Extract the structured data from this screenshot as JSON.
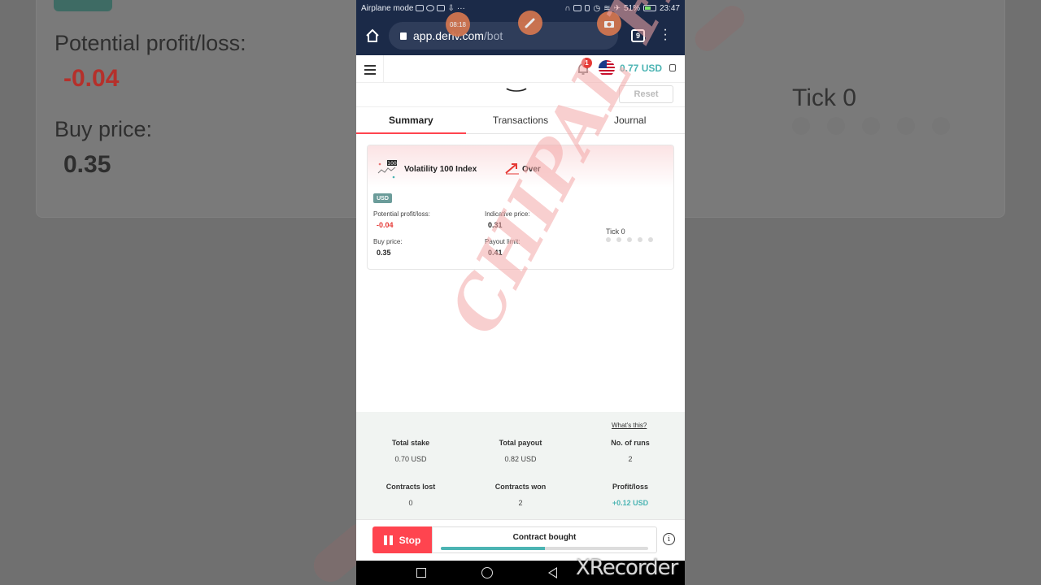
{
  "background": {
    "potential_label": "Potential profit/loss:",
    "potential_value": "-0.04",
    "buy_label": "Buy price:",
    "buy_value": "0.35",
    "tick_label": "Tick 0"
  },
  "statusbar": {
    "mode": "Airplane mode",
    "ellipsis": "···",
    "battery": "51%",
    "time": "23:47"
  },
  "recorder": {
    "timer": "08:18"
  },
  "browser": {
    "url_host": "app.deriv.com",
    "url_path": "/bot",
    "tab_count": "9"
  },
  "appbar": {
    "notification_count": "1",
    "balance": "0.77 USD"
  },
  "toolbar": {
    "reset_label": "Reset"
  },
  "tabs": [
    {
      "label": "Summary",
      "active": true
    },
    {
      "label": "Transactions",
      "active": false
    },
    {
      "label": "Journal",
      "active": false
    }
  ],
  "contract": {
    "icon_badge": "100",
    "market": "Volatility 100 Index",
    "type": "Over",
    "currency": "USD",
    "potential_label": "Potential profit/loss:",
    "potential_value": "-0.04",
    "indicative_label": "Indicative price:",
    "indicative_value": "0.31",
    "buy_label": "Buy price:",
    "buy_value": "0.35",
    "payout_label": "Payout limit:",
    "payout_value": "0.41",
    "tick_label": "Tick 0",
    "tick_dots": 5
  },
  "watermark": "CHIPAL FX",
  "stats": {
    "whats_this": "What's this?",
    "total_stake_label": "Total stake",
    "total_stake": "0.70 USD",
    "total_payout_label": "Total payout",
    "total_payout": "0.82 USD",
    "runs_label": "No. of runs",
    "runs": "2",
    "lost_label": "Contracts lost",
    "lost": "0",
    "won_label": "Contracts won",
    "won": "2",
    "pl_label": "Profit/loss",
    "pl": "+0.12 USD"
  },
  "runpanel": {
    "stop_label": "Stop",
    "status": "Contract bought",
    "progress": 0.5
  },
  "overlay": {
    "brand": "XRecorder"
  },
  "colors": {
    "accent_red": "#ff444f",
    "teal": "#4bb4b3",
    "chrome_navy": "#1b2a48"
  }
}
